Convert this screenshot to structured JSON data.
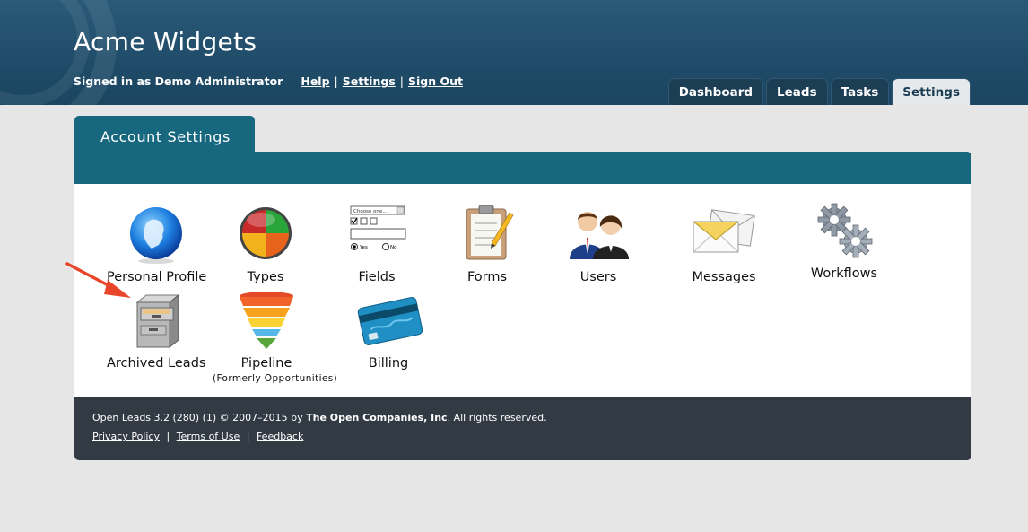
{
  "header": {
    "app_title": "Acme Widgets",
    "signed_in": "Signed in as Demo Administrator",
    "links": {
      "help": "Help",
      "settings": "Settings",
      "sign_out": "Sign Out"
    },
    "separator": "|"
  },
  "tabs": [
    {
      "label": "Dashboard",
      "active": false
    },
    {
      "label": "Leads",
      "active": false
    },
    {
      "label": "Tasks",
      "active": false
    },
    {
      "label": "Settings",
      "active": true
    }
  ],
  "panel": {
    "title": "Account Settings",
    "items": [
      {
        "label": "Personal Profile",
        "icon": "person-icon"
      },
      {
        "label": "Types",
        "icon": "types-pie-icon"
      },
      {
        "label": "Fields",
        "icon": "form-fields-icon",
        "fields_icon": {
          "select_text": "Choose one...",
          "yes": "Yes",
          "no": "No"
        }
      },
      {
        "label": "Forms",
        "icon": "clipboard-icon"
      },
      {
        "label": "Users",
        "icon": "users-icon"
      },
      {
        "label": "Messages",
        "icon": "envelopes-icon"
      },
      {
        "label": "Workflows",
        "icon": "gears-icon"
      },
      {
        "label": "Archived Leads",
        "icon": "file-cabinet-icon"
      },
      {
        "label": "Pipeline",
        "sublabel": "(Formerly Opportunities)",
        "icon": "funnel-icon"
      },
      {
        "label": "Billing",
        "icon": "credit-card-icon"
      }
    ]
  },
  "footer": {
    "copyright_prefix": "Open Leads 3.2 (280) (1) © 2007–2015 by ",
    "company": "The Open Companies, Inc",
    "copyright_suffix": ". All rights reserved.",
    "links": {
      "privacy": "Privacy Policy",
      "terms": "Terms of Use",
      "feedback": "Feedback"
    },
    "separator": "|"
  },
  "colors": {
    "header_bg": "#1f4c69",
    "panel_teal": "#17677f",
    "footer_bg": "#323a44",
    "page_bg": "#e6e6e6",
    "annotation_arrow": "#e8452a"
  }
}
